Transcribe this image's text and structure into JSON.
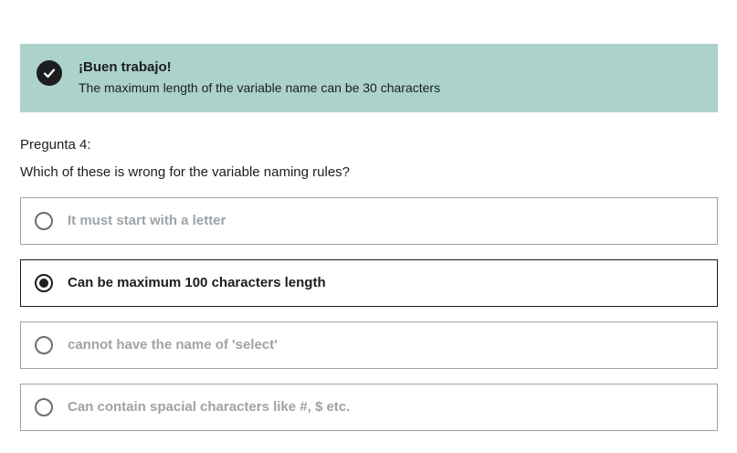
{
  "feedback": {
    "title": "¡Buen trabajo!",
    "message": "The maximum length of the variable name can be 30 characters",
    "icon": "check-circle-icon",
    "color": "#acd2cc"
  },
  "question": {
    "number_label": "Pregunta 4:",
    "text": "Which of these is wrong for the variable naming rules?"
  },
  "options": [
    {
      "label": "It must start with a letter",
      "selected": false
    },
    {
      "label": "Can be maximum 100 characters length",
      "selected": true
    },
    {
      "label": "cannot have the name of 'select'",
      "selected": false
    },
    {
      "label": "Can contain spacial characters like #, $ etc.",
      "selected": false
    }
  ]
}
